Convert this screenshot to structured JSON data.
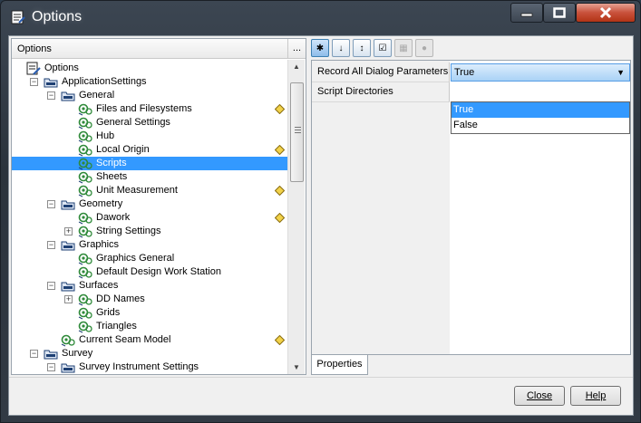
{
  "window": {
    "title": "Options",
    "controls": {
      "minimize": "minimize-icon",
      "maximize": "maximize-icon",
      "close": "close-icon"
    }
  },
  "left_pane": {
    "header": "Options",
    "header_button": "...",
    "tree": [
      {
        "label": "Options",
        "level": 0,
        "icon": "options-icon",
        "expander": "",
        "modified": false,
        "selected": false
      },
      {
        "label": "ApplicationSettings",
        "level": 1,
        "icon": "folder-icon",
        "expander": "-",
        "modified": false,
        "selected": false
      },
      {
        "label": "General",
        "level": 2,
        "icon": "folder-icon",
        "expander": "-",
        "modified": false,
        "selected": false
      },
      {
        "label": "Files and Filesystems",
        "level": 3,
        "icon": "settings-gears-icon",
        "expander": "",
        "modified": true,
        "selected": false
      },
      {
        "label": "General Settings",
        "level": 3,
        "icon": "settings-gears-icon",
        "expander": "",
        "modified": false,
        "selected": false
      },
      {
        "label": "Hub",
        "level": 3,
        "icon": "settings-gears-icon",
        "expander": "",
        "modified": false,
        "selected": false
      },
      {
        "label": "Local Origin",
        "level": 3,
        "icon": "settings-gears-icon",
        "expander": "",
        "modified": true,
        "selected": false
      },
      {
        "label": "Scripts",
        "level": 3,
        "icon": "settings-gears-icon",
        "expander": "",
        "modified": false,
        "selected": true
      },
      {
        "label": "Sheets",
        "level": 3,
        "icon": "settings-gears-icon",
        "expander": "",
        "modified": false,
        "selected": false
      },
      {
        "label": "Unit Measurement",
        "level": 3,
        "icon": "settings-gears-icon",
        "expander": "",
        "modified": true,
        "selected": false
      },
      {
        "label": "Geometry",
        "level": 2,
        "icon": "folder-icon",
        "expander": "-",
        "modified": false,
        "selected": false
      },
      {
        "label": "Dawork",
        "level": 3,
        "icon": "settings-gears-icon",
        "expander": "",
        "modified": true,
        "selected": false
      },
      {
        "label": "String Settings",
        "level": 3,
        "icon": "settings-gears-icon",
        "expander": "+",
        "modified": false,
        "selected": false
      },
      {
        "label": "Graphics",
        "level": 2,
        "icon": "folder-icon",
        "expander": "-",
        "modified": false,
        "selected": false
      },
      {
        "label": "Graphics General",
        "level": 3,
        "icon": "settings-gears-icon",
        "expander": "",
        "modified": false,
        "selected": false
      },
      {
        "label": "Default Design Work Station",
        "level": 3,
        "icon": "settings-gears-icon",
        "expander": "",
        "modified": false,
        "selected": false
      },
      {
        "label": "Surfaces",
        "level": 2,
        "icon": "folder-icon",
        "expander": "-",
        "modified": false,
        "selected": false
      },
      {
        "label": "DD Names",
        "level": 3,
        "icon": "settings-gears-icon",
        "expander": "+",
        "modified": false,
        "selected": false
      },
      {
        "label": "Grids",
        "level": 3,
        "icon": "settings-gears-icon",
        "expander": "",
        "modified": false,
        "selected": false
      },
      {
        "label": "Triangles",
        "level": 3,
        "icon": "settings-gears-icon",
        "expander": "",
        "modified": false,
        "selected": false
      },
      {
        "label": "Current Seam Model",
        "level": 2,
        "icon": "settings-gears-icon",
        "expander": "",
        "modified": true,
        "selected": false
      },
      {
        "label": "Survey",
        "level": 1,
        "icon": "folder-icon",
        "expander": "-",
        "modified": false,
        "selected": false
      },
      {
        "label": "Survey Instrument Settings",
        "level": 2,
        "icon": "folder-icon",
        "expander": "-",
        "modified": false,
        "selected": false
      }
    ]
  },
  "right_pane": {
    "toolbar": [
      {
        "name": "categorized-icon",
        "glyph": "✱",
        "state": "active"
      },
      {
        "name": "sort-az-icon",
        "glyph": "↓",
        "state": "normal"
      },
      {
        "name": "sort-modified-icon",
        "glyph": "↕",
        "state": "normal"
      },
      {
        "name": "checklist-icon",
        "glyph": "☑",
        "state": "normal"
      },
      {
        "name": "property-pages-icon",
        "glyph": "▦",
        "state": "disabled"
      },
      {
        "name": "info-icon",
        "glyph": "●",
        "state": "disabled"
      }
    ],
    "properties": [
      {
        "name": "Record All Dialog Parameters",
        "value": "True"
      },
      {
        "name": "Script Directories",
        "value": ""
      }
    ],
    "dropdown_options": [
      "True",
      "False"
    ],
    "highlighted_option": "True",
    "tab": "Properties"
  },
  "buttons": {
    "close": "Close",
    "help": "Help"
  },
  "colors": {
    "selection": "#3399ff",
    "modified_marker": "#f2d24a",
    "tree_icon": "#2f8a3a"
  }
}
